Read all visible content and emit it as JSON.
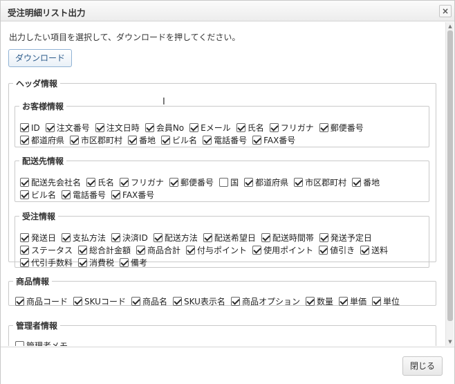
{
  "dialog": {
    "title": "受注明細リスト出力",
    "close_glyph": "×",
    "instruction": "出力したい項目を選択して、ダウンロードを押してください。",
    "download_label": "ダウンロード",
    "close_button_label": "閉じる"
  },
  "header_group": {
    "legend": "ヘッダ情報",
    "customer": {
      "legend": "お客様情報",
      "rows": [
        [
          {
            "label": "ID",
            "checked": true
          },
          {
            "label": "注文番号",
            "checked": true
          },
          {
            "label": "注文日時",
            "checked": true
          },
          {
            "label": "会員No",
            "checked": true
          },
          {
            "label": "Eメール",
            "checked": true
          },
          {
            "label": "氏名",
            "checked": true
          },
          {
            "label": "フリガナ",
            "checked": true
          },
          {
            "label": "郵便番号",
            "checked": true
          }
        ],
        [
          {
            "label": "都道府県",
            "checked": true
          },
          {
            "label": "市区郡町村",
            "checked": true
          },
          {
            "label": "番地",
            "checked": true
          },
          {
            "label": "ビル名",
            "checked": true
          },
          {
            "label": "電話番号",
            "checked": true
          },
          {
            "label": "FAX番号",
            "checked": true
          }
        ]
      ]
    },
    "delivery": {
      "legend": "配送先情報",
      "rows": [
        [
          {
            "label": "配送先会社名",
            "checked": true
          },
          {
            "label": "氏名",
            "checked": true
          },
          {
            "label": "フリガナ",
            "checked": true
          },
          {
            "label": "郵便番号",
            "checked": true
          },
          {
            "label": "国",
            "checked": false
          },
          {
            "label": "都道府県",
            "checked": true
          },
          {
            "label": "市区郡町村",
            "checked": true
          },
          {
            "label": "番地",
            "checked": true
          }
        ],
        [
          {
            "label": "ビル名",
            "checked": true
          },
          {
            "label": "電話番号",
            "checked": true
          },
          {
            "label": "FAX番号",
            "checked": true
          }
        ]
      ]
    },
    "order": {
      "legend": "受注情報",
      "rows": [
        [
          {
            "label": "発送日",
            "checked": true
          },
          {
            "label": "支払方法",
            "checked": true
          },
          {
            "label": "決済ID",
            "checked": true
          },
          {
            "label": "配送方法",
            "checked": true
          },
          {
            "label": "配送希望日",
            "checked": true
          },
          {
            "label": "配送時間帯",
            "checked": true
          },
          {
            "label": "発送予定日",
            "checked": true
          }
        ],
        [
          {
            "label": "ステータス",
            "checked": true
          },
          {
            "label": "総合計金額",
            "checked": true
          },
          {
            "label": "商品合計",
            "checked": true
          },
          {
            "label": "付与ポイント",
            "checked": true
          },
          {
            "label": "使用ポイント",
            "checked": true
          },
          {
            "label": "値引き",
            "checked": true
          },
          {
            "label": "送料",
            "checked": true
          }
        ],
        [
          {
            "label": "代引手数料",
            "checked": true
          },
          {
            "label": "消費税",
            "checked": true
          },
          {
            "label": "備考",
            "checked": true
          }
        ]
      ]
    }
  },
  "product": {
    "legend": "商品情報",
    "rows": [
      [
        {
          "label": "商品コード",
          "checked": true
        },
        {
          "label": "SKUコード",
          "checked": true
        },
        {
          "label": "商品名",
          "checked": true
        },
        {
          "label": "SKU表示名",
          "checked": true
        },
        {
          "label": "商品オプション",
          "checked": true
        },
        {
          "label": "数量",
          "checked": true
        },
        {
          "label": "単価",
          "checked": true
        },
        {
          "label": "単位",
          "checked": true
        }
      ]
    ]
  },
  "admin": {
    "legend": "管理者情報",
    "rows": [
      [
        {
          "label": "管理者メモ",
          "checked": false
        }
      ]
    ]
  }
}
